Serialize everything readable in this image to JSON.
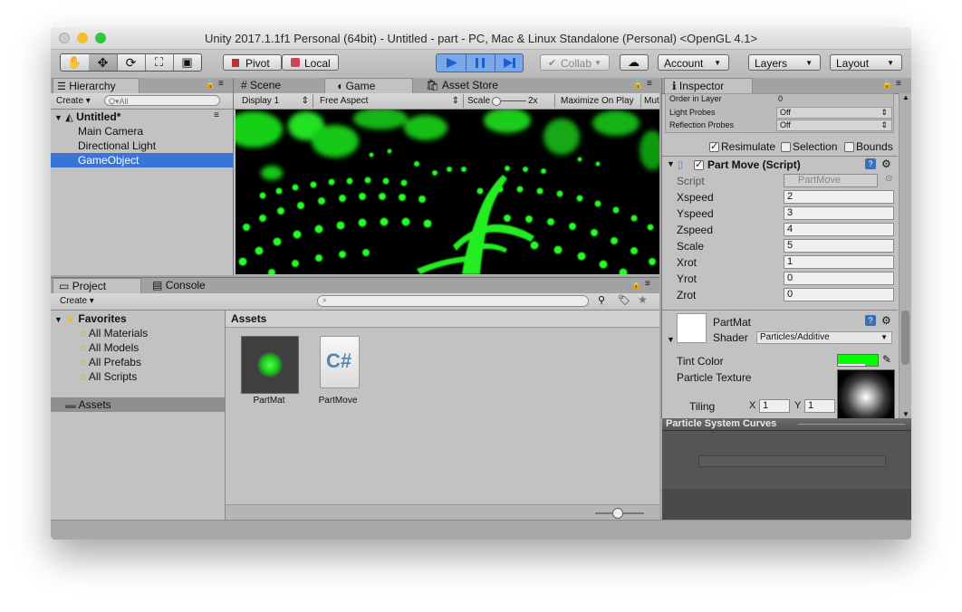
{
  "window": {
    "title": "Unity 2017.1.1f1 Personal (64bit) - Untitled - part - PC, Mac & Linux Standalone (Personal) <OpenGL 4.1>"
  },
  "toolbar": {
    "pivot": "Pivot",
    "local": "Local",
    "collab": "Collab",
    "account": "Account",
    "layers": "Layers",
    "layout": "Layout"
  },
  "hierarchy": {
    "tab": "Hierarchy",
    "create": "Create",
    "search_placeholder": "Q▾All",
    "scene": "Untitled*",
    "items": [
      "Main Camera",
      "Directional Light",
      "GameObject"
    ],
    "selected": "GameObject"
  },
  "view_tabs": {
    "scene": "Scene",
    "game": "Game",
    "asset_store": "Asset Store"
  },
  "game_bar": {
    "display": "Display 1",
    "aspect": "Free Aspect",
    "scale_label": "Scale",
    "scale_value": "2x",
    "maximize": "Maximize On Play",
    "mute": "Mut"
  },
  "project": {
    "tab": "Project",
    "console_tab": "Console",
    "create": "Create",
    "favorites": "Favorites",
    "fav_items": [
      "All Materials",
      "All Models",
      "All Prefabs",
      "All Scripts"
    ],
    "assets_folder": "Assets",
    "assets_header": "Assets",
    "assets": [
      {
        "name": "PartMat",
        "icon": "material-thumbnail"
      },
      {
        "name": "PartMove",
        "icon": "csharp-script-icon"
      }
    ]
  },
  "inspector": {
    "tab": "Inspector",
    "renderer_rows": [
      {
        "label": "Order in Layer",
        "value": "0"
      },
      {
        "label": "Light Probes",
        "value": "Off"
      },
      {
        "label": "Reflection Probes",
        "value": "Off"
      }
    ],
    "resimulate": "Resimulate",
    "selection": "Selection",
    "bounds": "Bounds",
    "component_title": "Part Move (Script)",
    "script_label": "Script",
    "script_value": "PartMove",
    "fields": [
      {
        "label": "Xspeed",
        "value": "2"
      },
      {
        "label": "Yspeed",
        "value": "3"
      },
      {
        "label": "Zspeed",
        "value": "4"
      },
      {
        "label": "Scale",
        "value": "5"
      },
      {
        "label": "Xrot",
        "value": "1"
      },
      {
        "label": "Yrot",
        "value": "0"
      },
      {
        "label": "Zrot",
        "value": "0"
      }
    ],
    "material_name": "PartMat",
    "shader_label": "Shader",
    "shader_value": "Particles/Additive",
    "tint_label": "Tint Color",
    "tint_color": "#00ff00",
    "texture_label": "Particle Texture",
    "tiling_label": "Tiling",
    "x_label": "X",
    "x_value": "1",
    "y_label": "Y",
    "y_value": "1",
    "curves_title": "Particle System Curves"
  },
  "colors": {
    "selection": "#3875d6",
    "play_active": "#7aa7e6",
    "particle_green": "#27ff27"
  }
}
